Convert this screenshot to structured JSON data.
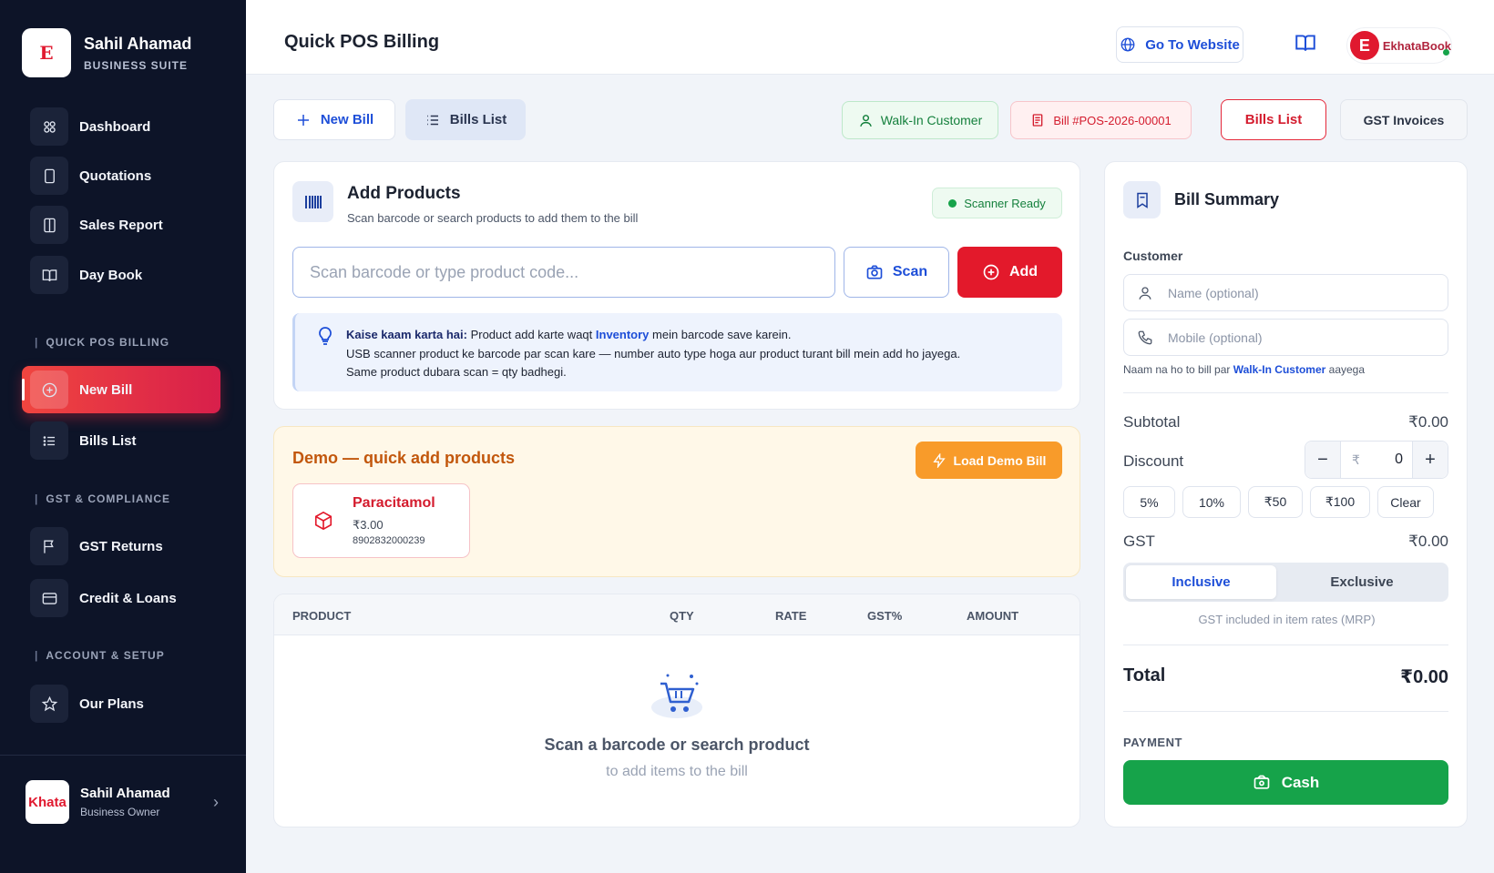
{
  "sidebar": {
    "brand": {
      "logo_text": "E",
      "name": "Sahil Ahamad",
      "subtitle": "BUSINESS SUITE"
    },
    "items_main": [
      {
        "label": "Dashboard",
        "icon": "dashboard-icon"
      },
      {
        "label": "Quotations",
        "icon": "quotation-icon"
      },
      {
        "label": "Sales Report",
        "icon": "report-icon"
      },
      {
        "label": "Day Book",
        "icon": "book-icon"
      }
    ],
    "section_pos": "QUICK POS BILLING",
    "items_pos": [
      {
        "label": "New Bill",
        "icon": "plus-circle-icon",
        "active": true
      },
      {
        "label": "Bills List",
        "icon": "list-icon"
      }
    ],
    "section_gst": "GST & COMPLIANCE",
    "items_gst": [
      {
        "label": "GST Returns",
        "icon": "flag-icon"
      },
      {
        "label": "Credit & Loans",
        "icon": "card-icon"
      }
    ],
    "section_account": "ACCOUNT & SETUP",
    "items_account": [
      {
        "label": "Our Plans",
        "icon": "star-icon"
      }
    ],
    "user": {
      "logo_text": "Khata",
      "name": "Sahil Ahamad",
      "role": "Business Owner"
    }
  },
  "header": {
    "title": "Quick POS Billing",
    "goto_label": "Go To Website",
    "brand_initial": "E",
    "brand_name": "EkhataBook"
  },
  "actions": {
    "new_bill": "New Bill",
    "bills_list_tab": "Bills List",
    "customer_pill": "Walk-In Customer",
    "bill_number": "Bill #POS-2026-00001",
    "bills_list_btn": "Bills List",
    "gst_invoices": "GST Invoices"
  },
  "add_products": {
    "title": "Add Products",
    "subtitle": "Scan barcode or search products to add them to the bill",
    "status": "Scanner Ready",
    "input_placeholder": "Scan barcode or type product code...",
    "scan_label": "Scan",
    "add_label": "Add",
    "info_lead": "Kaise kaam karta hai:",
    "info_part1": " Product add karte waqt ",
    "info_link": "Inventory",
    "info_part2": " mein barcode save karein.",
    "info_line2": "USB scanner product ke barcode par scan kare — number auto type hoga aur product turant bill mein add ho jayega.",
    "info_line3": "Same product dubara scan = qty badhegi."
  },
  "demo": {
    "title": "Demo — quick add products",
    "load_label": "Load Demo Bill",
    "product": {
      "name": "Paracitamol",
      "price": "₹3.00",
      "code": "8902832000239"
    }
  },
  "table": {
    "columns": [
      "PRODUCT",
      "QTY",
      "RATE",
      "GST%",
      "AMOUNT"
    ],
    "empty_title": "Scan a barcode or search product",
    "empty_sub": "to add items to the bill"
  },
  "summary": {
    "title": "Bill Summary",
    "customer_label": "Customer",
    "name_placeholder": "Name (optional)",
    "mobile_placeholder": "Mobile (optional)",
    "hint_pre": "Naam na ho to bill par ",
    "hint_bold": "Walk-In Customer",
    "hint_post": " aayega",
    "subtotal_label": "Subtotal",
    "subtotal_value": "₹0.00",
    "discount_label": "Discount",
    "discount_currency": "₹",
    "discount_value": "0",
    "chips": [
      "5%",
      "10%",
      "₹50",
      "₹100",
      "Clear"
    ],
    "gst_label": "GST",
    "gst_value": "₹0.00",
    "gst_mode_inclusive": "Inclusive",
    "gst_mode_exclusive": "Exclusive",
    "gst_note": "GST included in item rates (MRP)",
    "total_label": "Total",
    "total_value": "₹0.00",
    "payment_label": "PAYMENT",
    "cash_label": "Cash"
  },
  "colors": {
    "accent_red": "#e3192b",
    "accent_blue": "#1d4ed8",
    "success_green": "#16a34a",
    "sidebar_bg": "#0d1428"
  }
}
